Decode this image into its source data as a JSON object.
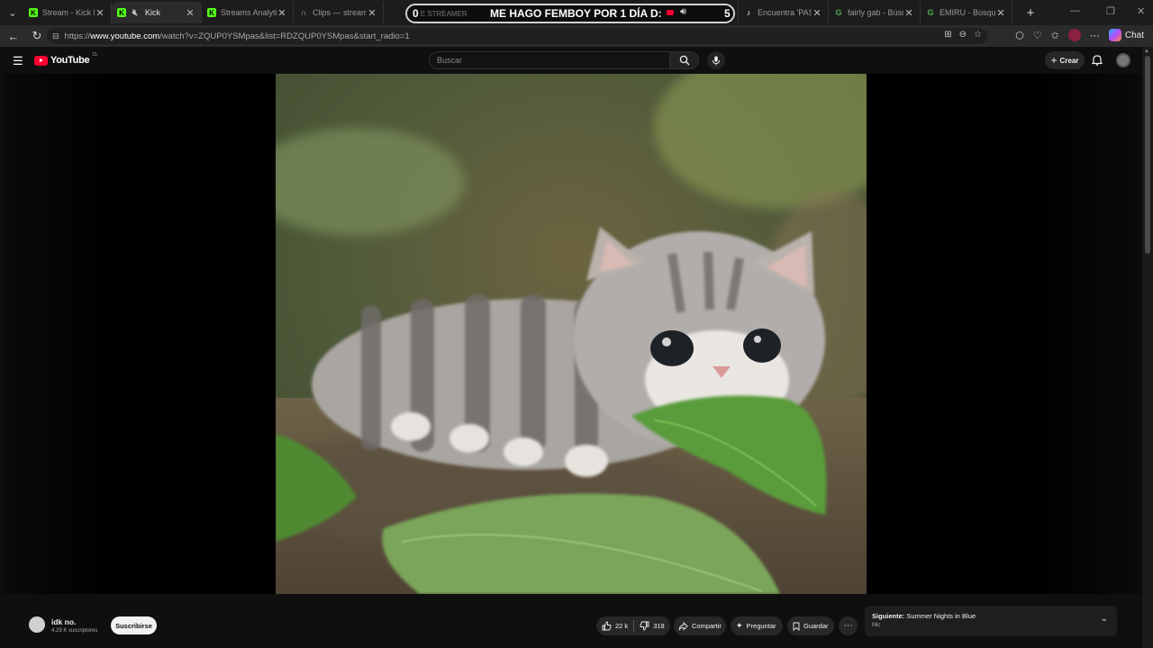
{
  "browser": {
    "tabs": [
      {
        "label": "Stream - Kick Das",
        "favicon": "kick-icon",
        "active": false
      },
      {
        "label": "Kick",
        "favicon": "kick-icon",
        "muted": true,
        "active": true
      },
      {
        "label": "Streams Analytic",
        "favicon": "kick-icon",
        "active": false
      },
      {
        "label": "Clips — streamer",
        "favicon": "headphones-icon",
        "active": false
      },
      {
        "label": "",
        "favicon": "",
        "active": false
      },
      {
        "label": "",
        "favicon": "",
        "active": false
      },
      {
        "label": "Encuentra 'PASAN",
        "favicon": "tiktok-icon",
        "active": false
      },
      {
        "label": "fairly gab - Búsq",
        "favicon": "google-icon",
        "active": false
      },
      {
        "label": "EMIRU - Búsqued",
        "favicon": "google-icon",
        "active": false
      }
    ],
    "url_prefix": "https://",
    "url_host": "www.youtube.com",
    "url_path": "/watch?v=ZQUP0YSMpas&list=RDZQUP0YSMpas&start_radio=1",
    "chat_label": "Chat"
  },
  "overlay": {
    "left_number": "0",
    "ghost_text": "E STREAMER",
    "title": "ME HAGO FEMBOY POR 1 DÍA D:",
    "right_number": "5"
  },
  "youtube": {
    "logo_text": "YouTube",
    "country_code": "CL",
    "search_placeholder": "Buscar",
    "create_label": "Crear"
  },
  "channel": {
    "name": "idk no.",
    "subscribers": "4.29 K suscriptores",
    "subscribe_label": "Suscribirse"
  },
  "actions": {
    "likes": "22 k",
    "dislikes": "318",
    "share_label": "Compartir",
    "ask_label": "Preguntar",
    "save_label": "Guardar"
  },
  "up_next": {
    "prefix": "Siguiente:",
    "title": "Summer Nights in Blue",
    "artist": "Mic"
  },
  "colors": {
    "brand_red": "#ff0033",
    "kick_green": "#53fc18",
    "background": "#0f0f0f"
  }
}
